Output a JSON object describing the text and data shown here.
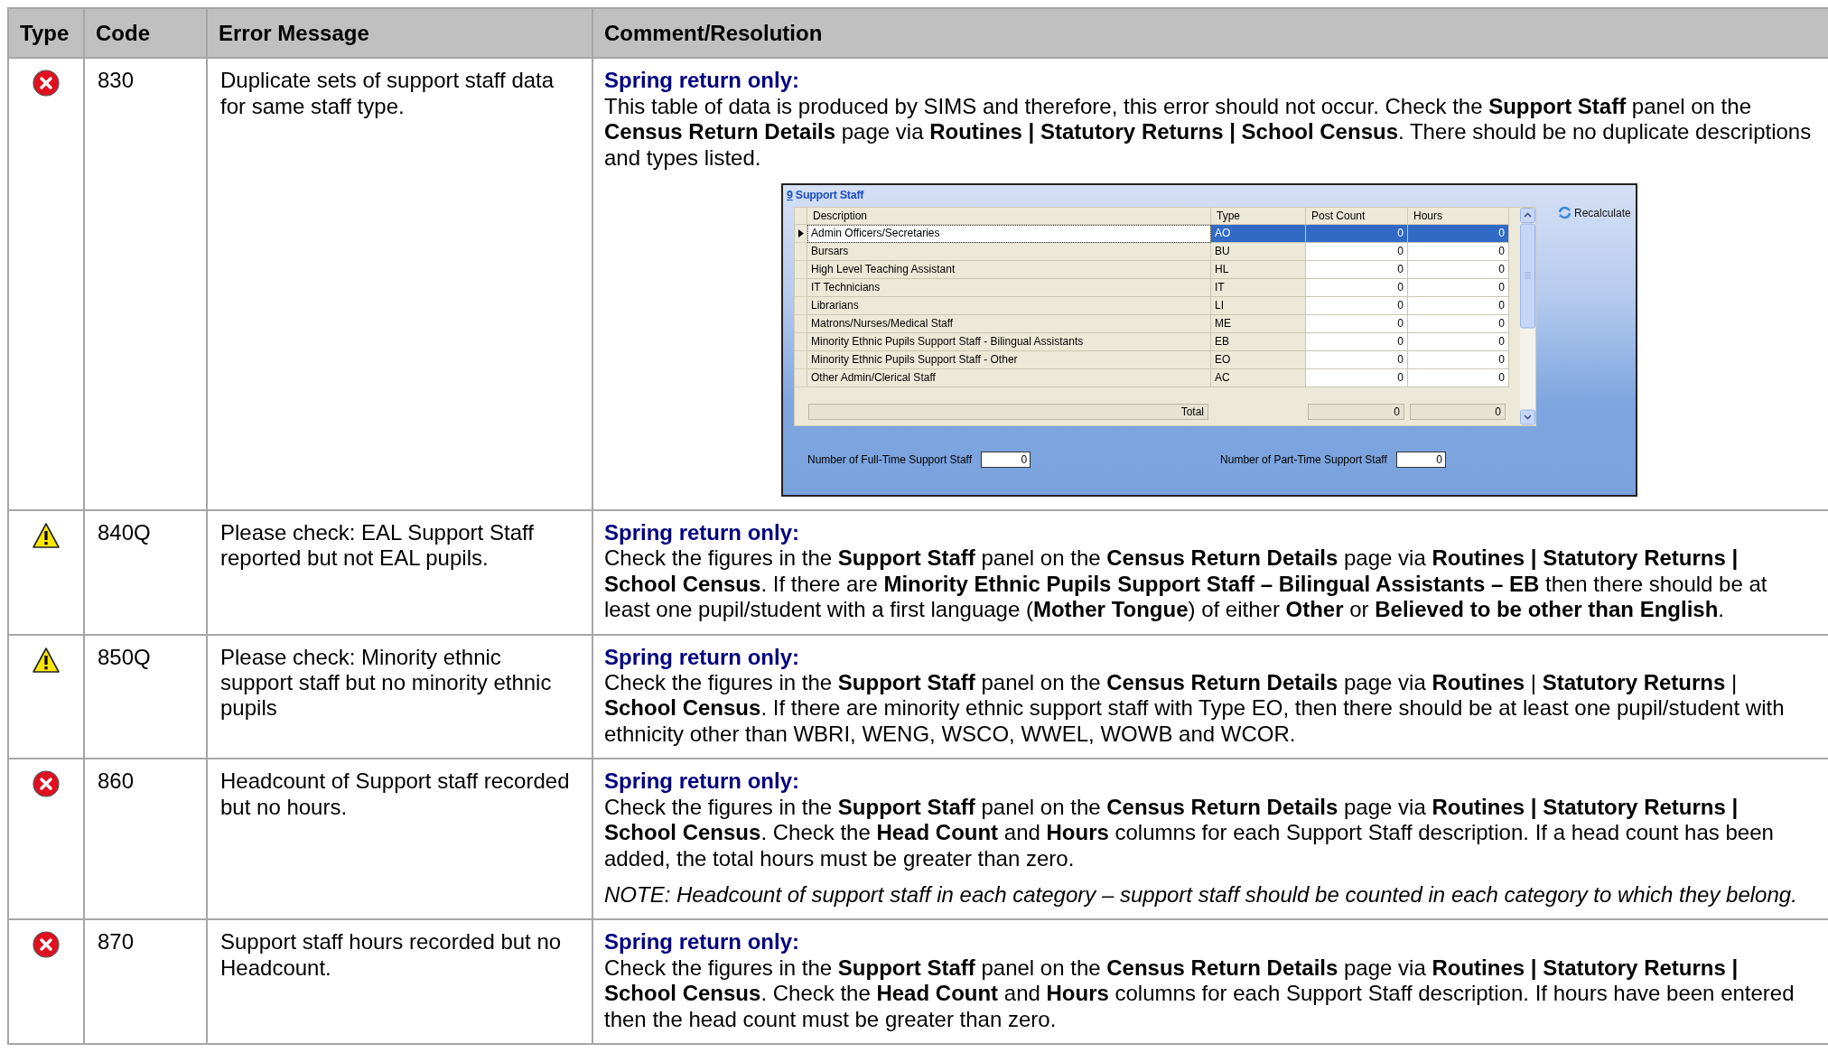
{
  "table": {
    "columns": [
      "Type",
      "Code",
      "Error Message",
      "Comment/Resolution"
    ],
    "rows": [
      {
        "kind": "error",
        "code": "830",
        "message": "Duplicate sets of support staff data for same staff type.",
        "comment": {
          "heading": "Spring return only:",
          "paragraphs": [
            {
              "kind": "text",
              "text": "This table of data is produced by SIMS and therefore, this error should not occur. Check the **Support Staff** panel on the **Census Return Details** page via **Routines | Statutory Returns | School Census**. There should be no duplicate descriptions and types listed."
            }
          ],
          "panel": {
            "number": "9",
            "title": "Support Staff",
            "columns": [
              "Description",
              "Type",
              "Post Count",
              "Hours"
            ],
            "rows": [
              {
                "description": "Admin Officers/Secretaries",
                "type": "AO",
                "post_count": "0",
                "hours": "0",
                "selected": true
              },
              {
                "description": "Bursars",
                "type": "BU",
                "post_count": "0",
                "hours": "0",
                "selected": false
              },
              {
                "description": "High Level Teaching Assistant",
                "type": "HL",
                "post_count": "0",
                "hours": "0",
                "selected": false
              },
              {
                "description": "IT Technicians",
                "type": "IT",
                "post_count": "0",
                "hours": "0",
                "selected": false
              },
              {
                "description": "Librarians",
                "type": "LI",
                "post_count": "0",
                "hours": "0",
                "selected": false
              },
              {
                "description": "Matrons/Nurses/Medical Staff",
                "type": "ME",
                "post_count": "0",
                "hours": "0",
                "selected": false
              },
              {
                "description": "Minority Ethnic Pupils Support Staff - Bilingual Assistants",
                "type": "EB",
                "post_count": "0",
                "hours": "0",
                "selected": false
              },
              {
                "description": "Minority Ethnic Pupils Support Staff - Other",
                "type": "EO",
                "post_count": "0",
                "hours": "0",
                "selected": false
              },
              {
                "description": "Other Admin/Clerical Staff",
                "type": "AC",
                "post_count": "0",
                "hours": "0",
                "selected": false
              }
            ],
            "total_label": "Total",
            "total_post_count": "0",
            "total_hours": "0",
            "recalculate": "Recalculate",
            "fields": [
              {
                "label": "Number of Full-Time Support Staff",
                "value": "0"
              },
              {
                "label": "Number of Part-Time Support Staff",
                "value": "0"
              }
            ]
          }
        }
      },
      {
        "kind": "warning",
        "code": "840Q",
        "message": "Please check: EAL Support Staff reported but not EAL pupils.",
        "comment": {
          "heading": "Spring return only:",
          "paragraphs": [
            {
              "kind": "text",
              "text": "Check the figures in the **Support Staff** panel on the **Census Return Details** page via **Routines | Statutory Returns | School Census**. If there are **Minority Ethnic Pupils Support Staff – Bilingual Assistants – EB** then there should be at least one pupil/student with a first language (**Mother Tongue**) of either **Other** or **Believed to be other than English**."
            }
          ]
        }
      },
      {
        "kind": "warning",
        "code": "850Q",
        "message": "Please check: Minority ethnic support staff but no minority ethnic pupils",
        "comment": {
          "heading": "Spring return only:",
          "paragraphs": [
            {
              "kind": "text",
              "text": "Check the figures in the **Support Staff** panel on the **Census Return Details** page via **Routines** | **Statutory Returns** | **School Census**. If there are minority ethnic support staff with Type EO, then there should be at least one pupil/student with ethnicity other than WBRI, WENG, WSCO, WWEL, WOWB and WCOR."
            }
          ]
        }
      },
      {
        "kind": "error",
        "code": "860",
        "message": "Headcount of Support staff recorded but no hours.",
        "comment": {
          "heading": "Spring return only:",
          "paragraphs": [
            {
              "kind": "text",
              "text": "Check the figures in the **Support Staff** panel on the **Census Return Details** page via **Routines | Statutory Returns | School Census**. Check the **Head Count** and **Hours** columns for each Support Staff description. If a head count has been added, the total hours must be greater than zero."
            },
            {
              "kind": "note",
              "text": "NOTE: Headcount of support staff in each category – support staff should be counted in each category to which they belong."
            }
          ]
        }
      },
      {
        "kind": "error",
        "code": "870",
        "message": "Support staff hours recorded but no Headcount.",
        "comment": {
          "heading": "Spring return only:",
          "paragraphs": [
            {
              "kind": "text",
              "text": "Check the figures in the **Support Staff** panel on the **Census Return Details** page via **Routines | Statutory Returns | School Census**. Check the **Head Count** and **Hours** columns for each Support Staff description. If hours have been entered then the head count must be greater than zero."
            }
          ]
        }
      }
    ]
  }
}
